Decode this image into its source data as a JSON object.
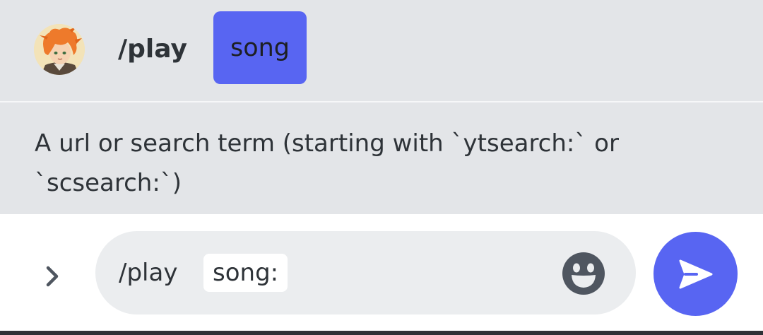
{
  "command_header": {
    "command_name": "/play",
    "active_option": "song"
  },
  "description": {
    "text": "A url or search term (starting with `ytsearch:` or `scsearch:`)"
  },
  "composer": {
    "command": "/play",
    "option_token": "song:"
  },
  "icons": {
    "avatar": "user-avatar",
    "expand": "chevron-right-icon",
    "emoji": "smiley-face-icon",
    "send": "send-icon"
  },
  "colors": {
    "accent": "#5865f2",
    "panel_background": "#e3e5e8",
    "input_background": "#ebedef",
    "text": "#2e3338",
    "icon": "#4f5660"
  }
}
